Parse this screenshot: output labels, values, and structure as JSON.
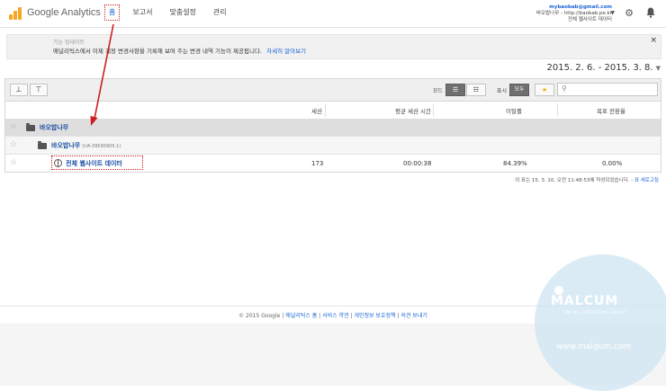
{
  "header": {
    "logo_text": "Google Analytics",
    "nav": [
      {
        "label": "홈",
        "active": true
      },
      {
        "label": "보고서",
        "active": false
      },
      {
        "label": "맞춤설정",
        "active": false
      },
      {
        "label": "관리",
        "active": false
      }
    ],
    "account_email": "mybaobab@gmail.com",
    "account_property": "바오밥나무 - http://baobab.pe.kr",
    "account_view": "전체 웹사이트 데이터",
    "icons": [
      "gear-icon",
      "bell-icon",
      "chevron-down-icon"
    ]
  },
  "banner": {
    "title": "기능 업데이트",
    "text": "애널리틱스에서 이제 계정 변경사항을 기록해 보여 주는 변경 내역 기능이 제공됩니다.",
    "link": "자세히 알아보기",
    "close": "×"
  },
  "date_range": "2015. 2. 6. - 2015. 3. 8.",
  "toolbar": {
    "mode_label": "모드",
    "show_label": "표시",
    "show_all": "모두",
    "star": "★",
    "search_icon": "search-icon"
  },
  "table": {
    "columns": [
      "세션",
      "평균 세션 시간",
      "이탈률",
      "목표 전환율"
    ],
    "rows": [
      {
        "type": "account",
        "label": "바오밥나무",
        "sub": "",
        "values": [
          "",
          "",
          "",
          ""
        ]
      },
      {
        "type": "property",
        "label": "바오밥나무",
        "sub": "(UA-39590905-1)",
        "values": [
          "",
          "",
          "",
          ""
        ]
      },
      {
        "type": "view",
        "label": "전체 웹사이트 데이터",
        "sub": "",
        "values": [
          "173",
          "00:00:38",
          "84.39%",
          "0.00%"
        ]
      }
    ]
  },
  "timestamp": {
    "text": "이 표는 15. 3. 10. 오전 11:48:53에 작성되었습니다. -",
    "link": "표 새로고침"
  },
  "footer": {
    "copyright": "© 2015 Google",
    "links": [
      "애널리틱스 홈",
      "서비스 약관",
      "개인정보 보호정책",
      "의견 보내기"
    ]
  },
  "watermark": {
    "brand": "MALCUM",
    "tagline": "ONLINE CONSULTING GROUP",
    "url": "www.malgum.com"
  },
  "colors": {
    "link": "#1a66d6",
    "highlight": "#cc1f1f",
    "accent": "#f5a623"
  }
}
